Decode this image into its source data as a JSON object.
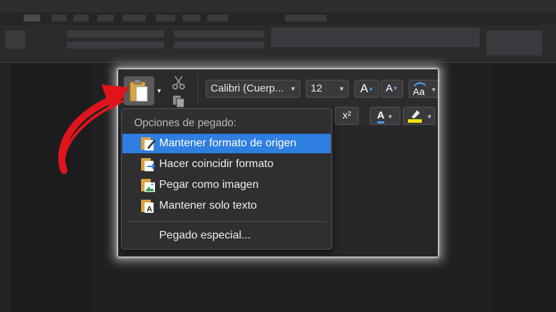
{
  "toolbar": {
    "font_name": "Calibri (Cuerp...",
    "font_size": "12",
    "grow_font_label": "A",
    "shrink_font_label": "A",
    "superscript_label": "x²",
    "font_color_label": "A"
  },
  "paste_menu": {
    "header": "Opciones de pegado:",
    "items": [
      {
        "label": "Mantener formato de origen",
        "icon": "keep-source-format-icon",
        "selected": true
      },
      {
        "label": "Hacer coincidir formato",
        "icon": "match-format-icon",
        "selected": false
      },
      {
        "label": "Pegar como imagen",
        "icon": "paste-picture-icon",
        "selected": false
      },
      {
        "label": "Mantener solo texto",
        "icon": "keep-text-only-icon",
        "selected": false
      }
    ],
    "special": "Pegado especial..."
  },
  "colors": {
    "selection": "#2f7fe0",
    "annotation_arrow": "#e1141b",
    "highlight_yellow": "#f5e400",
    "accent_blue": "#4aa3ff"
  }
}
